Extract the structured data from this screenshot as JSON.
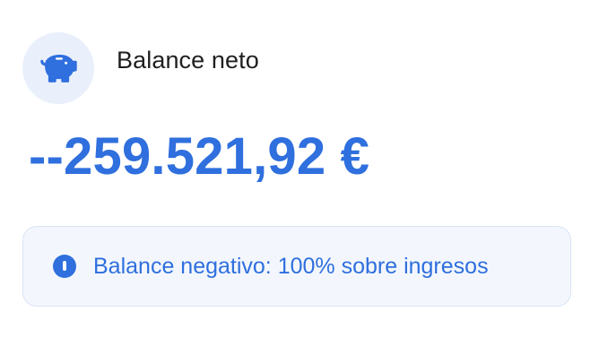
{
  "card": {
    "icon": "piggy-bank-icon",
    "title": "Balance neto",
    "amount": "--259.521,92 €",
    "alert": {
      "icon": "exclamation-circle-icon",
      "text": "Balance negativo: 100% sobre ingresos"
    }
  },
  "colors": {
    "accent": "#2f6fde",
    "icon_bg": "#e9f0fb",
    "alert_bg": "#f3f7fd",
    "alert_border": "#d8e4f6",
    "title_text": "#1f1f1f"
  }
}
